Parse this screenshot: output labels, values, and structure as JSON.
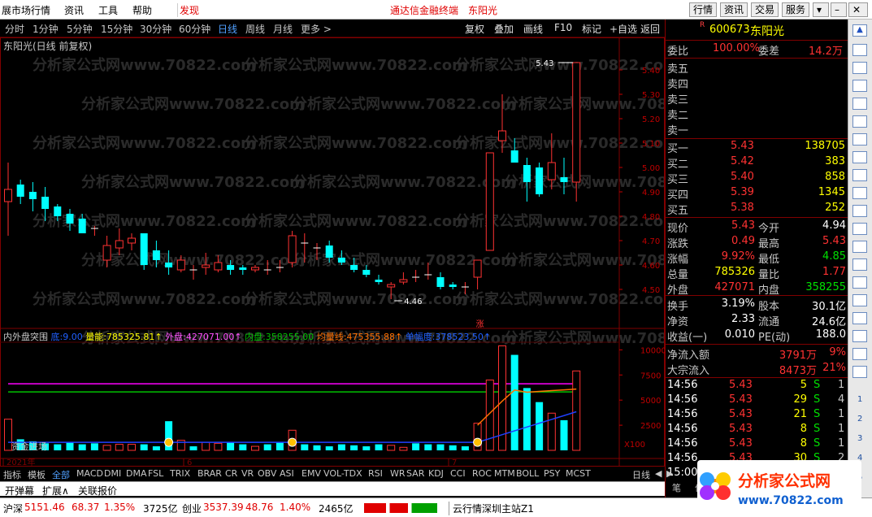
{
  "menubar": {
    "items": [
      "展市场行情",
      "资讯",
      "工具",
      "帮助"
    ],
    "discover": "发现",
    "title": "通达信金融终端",
    "stock_name": "东阳光",
    "buttons": [
      "行情",
      "资讯",
      "交易",
      "服务"
    ]
  },
  "periods": {
    "items": [
      "分时",
      "1分钟",
      "5分钟",
      "15分钟",
      "30分钟",
      "60分钟",
      "日线",
      "周线",
      "月线",
      "更多 >"
    ],
    "active": "日线",
    "right_buttons": [
      "复权",
      "叠加",
      "画线",
      "F10",
      "标记",
      "+自选",
      "返回"
    ]
  },
  "chart_title": "东阳光(日线 前复权)",
  "watermark": "分析家公式网www.70822.com",
  "chart_data": [
    {
      "type": "candlestick",
      "title": "东阳光(日线 前复权)",
      "ylim": [
        4.4,
        5.5
      ],
      "y_ticks": [
        "5.40",
        "5.30",
        "5.20",
        "5.10",
        "5.00",
        "4.90",
        "4.80",
        "4.70",
        "4.60",
        "4.50"
      ],
      "high_label": "5.43",
      "low_label": "4.46",
      "limit_up_tag": "涨",
      "candles": [
        {
          "o": 4.86,
          "c": 4.91,
          "h": 5.02,
          "l": 4.72
        },
        {
          "o": 4.93,
          "c": 4.88,
          "h": 4.95,
          "l": 4.85
        },
        {
          "o": 4.9,
          "c": 4.87,
          "h": 4.94,
          "l": 4.82
        },
        {
          "o": 4.88,
          "c": 4.83,
          "h": 4.92,
          "l": 4.78
        },
        {
          "o": 4.84,
          "c": 4.8,
          "h": 4.85,
          "l": 4.78
        },
        {
          "o": 4.81,
          "c": 4.77,
          "h": 4.83,
          "l": 4.74
        },
        {
          "o": 4.79,
          "c": 4.73,
          "h": 4.81,
          "l": 4.73
        },
        {
          "o": 4.75,
          "c": 4.75,
          "h": 4.76,
          "l": 4.72
        },
        {
          "o": 4.62,
          "c": 4.68,
          "h": 4.72,
          "l": 4.59
        },
        {
          "o": 4.67,
          "c": 4.7,
          "h": 4.75,
          "l": 4.64
        },
        {
          "o": 4.69,
          "c": 4.71,
          "h": 4.73,
          "l": 4.66
        },
        {
          "o": 4.73,
          "c": 4.6,
          "h": 4.73,
          "l": 4.58
        },
        {
          "o": 4.66,
          "c": 4.62,
          "h": 4.7,
          "l": 4.59
        },
        {
          "o": 4.61,
          "c": 4.59,
          "h": 4.66,
          "l": 4.56
        },
        {
          "o": 4.58,
          "c": 4.62,
          "h": 4.64,
          "l": 4.57
        },
        {
          "o": 4.58,
          "c": 4.58,
          "h": 4.6,
          "l": 4.54
        },
        {
          "o": 4.59,
          "c": 4.6,
          "h": 4.65,
          "l": 4.56
        },
        {
          "o": 4.58,
          "c": 4.61,
          "h": 4.64,
          "l": 4.57
        },
        {
          "o": 4.6,
          "c": 4.58,
          "h": 4.62,
          "l": 4.56
        },
        {
          "o": 4.59,
          "c": 4.58,
          "h": 4.6,
          "l": 4.56
        },
        {
          "o": 4.58,
          "c": 4.59,
          "h": 4.6,
          "l": 4.57
        },
        {
          "o": 4.58,
          "c": 4.58,
          "h": 4.62,
          "l": 4.56
        },
        {
          "o": 4.59,
          "c": 4.59,
          "h": 4.62,
          "l": 4.57
        },
        {
          "o": 4.61,
          "c": 4.72,
          "h": 4.74,
          "l": 4.59
        },
        {
          "o": 4.69,
          "c": 4.69,
          "h": 4.73,
          "l": 4.61
        },
        {
          "o": 4.67,
          "c": 4.67,
          "h": 4.69,
          "l": 4.62
        },
        {
          "o": 4.68,
          "c": 4.63,
          "h": 4.7,
          "l": 4.61
        },
        {
          "o": 4.63,
          "c": 4.61,
          "h": 4.66,
          "l": 4.6
        },
        {
          "o": 4.6,
          "c": 4.58,
          "h": 4.63,
          "l": 4.57
        },
        {
          "o": 4.58,
          "c": 4.56,
          "h": 4.6,
          "l": 4.55
        },
        {
          "o": 4.54,
          "c": 4.53,
          "h": 4.56,
          "l": 4.52
        },
        {
          "o": 4.51,
          "c": 4.52,
          "h": 4.53,
          "l": 4.46
        },
        {
          "o": 4.53,
          "c": 4.54,
          "h": 4.57,
          "l": 4.52
        },
        {
          "o": 4.55,
          "c": 4.55,
          "h": 4.58,
          "l": 4.53
        },
        {
          "o": 4.56,
          "c": 4.56,
          "h": 4.61,
          "l": 4.54
        },
        {
          "o": 4.55,
          "c": 4.51,
          "h": 4.57,
          "l": 4.5
        },
        {
          "o": 4.52,
          "c": 4.51,
          "h": 4.53,
          "l": 4.5
        },
        {
          "o": 4.51,
          "c": 4.51,
          "h": 4.53,
          "l": 4.48
        },
        {
          "o": 4.55,
          "c": 4.62,
          "h": 4.62,
          "l": 4.5
        },
        {
          "o": 4.66,
          "c": 5.06,
          "h": 5.06,
          "l": 4.66
        },
        {
          "o": 5.11,
          "c": 5.15,
          "h": 5.3,
          "l": 5.06
        },
        {
          "o": 5.07,
          "c": 5.02,
          "h": 5.12,
          "l": 5.02
        },
        {
          "o": 5.01,
          "c": 4.94,
          "h": 5.04,
          "l": 4.86
        },
        {
          "o": 5.0,
          "c": 4.89,
          "h": 5.02,
          "l": 4.88
        },
        {
          "o": 4.95,
          "c": 5.02,
          "h": 5.14,
          "l": 4.91
        },
        {
          "o": 4.96,
          "c": 4.94,
          "h": 5.04,
          "l": 4.89
        },
        {
          "o": 4.94,
          "c": 5.43,
          "h": 5.43,
          "l": 4.86
        }
      ]
    },
    {
      "type": "bar",
      "title": "内外盘突围",
      "header": [
        {
          "name": "底",
          "value": "9.00"
        },
        {
          "name": "量能",
          "value": "785325.81↑"
        },
        {
          "name": "外盘",
          "value": "427071.00↑"
        },
        {
          "name": "内盘",
          "value": "358255.00"
        },
        {
          "name": "均量线",
          "value": "475355.88↑"
        },
        {
          "name": "单幅度",
          "value": "378523.50↑"
        }
      ],
      "overlay_label": "资金进场",
      "y_ticks": [
        "10000",
        "7500",
        "5000",
        "2500"
      ],
      "x100": "X100",
      "x_labels": [
        "2021年",
        "6",
        "7"
      ],
      "ylim": [
        0,
        11000
      ],
      "volumes": [
        3100,
        1100,
        900,
        700,
        600,
        800,
        600,
        700,
        500,
        600,
        600,
        600,
        400,
        2900,
        1000,
        400,
        800,
        700,
        800,
        600,
        400,
        600,
        800,
        2000,
        600,
        500,
        400,
        600,
        500,
        400,
        600,
        500,
        300,
        700,
        600,
        600,
        500,
        400,
        2700,
        7000,
        10400,
        9500,
        6200,
        4800,
        3700,
        3000,
        7900
      ],
      "up_flags": [
        1,
        0,
        0,
        0,
        0,
        0,
        0,
        0,
        1,
        1,
        1,
        0,
        0,
        0,
        1,
        0,
        1,
        1,
        0,
        0,
        1,
        0,
        0,
        1,
        0,
        0,
        0,
        0,
        0,
        0,
        0,
        1,
        1,
        0,
        0,
        0,
        0,
        0,
        1,
        1,
        1,
        0,
        0,
        0,
        1,
        0,
        1
      ],
      "signal_dots": [
        13,
        23,
        38
      ]
    }
  ],
  "quote": {
    "code": "600673",
    "name": "东阳光",
    "r_tag": "R",
    "weibi_label": "委比",
    "weibi": "100.00%",
    "weicha_label": "委差",
    "weicha": "14.2万",
    "sells": [
      {
        "label": "卖五",
        "price": "",
        "vol": ""
      },
      {
        "label": "卖四",
        "price": "",
        "vol": ""
      },
      {
        "label": "卖三",
        "price": "",
        "vol": ""
      },
      {
        "label": "卖二",
        "price": "",
        "vol": ""
      },
      {
        "label": "卖一",
        "price": "",
        "vol": ""
      }
    ],
    "buys": [
      {
        "label": "买一",
        "price": "5.43",
        "vol": "138705"
      },
      {
        "label": "买二",
        "price": "5.42",
        "vol": "383"
      },
      {
        "label": "买三",
        "price": "5.40",
        "vol": "858"
      },
      {
        "label": "买四",
        "price": "5.39",
        "vol": "1345"
      },
      {
        "label": "买五",
        "price": "5.38",
        "vol": "252"
      }
    ],
    "stats": [
      {
        "l1": "现价",
        "v1": "5.43",
        "c1": "red",
        "l2": "今开",
        "v2": "4.94",
        "c2": "wht"
      },
      {
        "l1": "涨跌",
        "v1": "0.49",
        "c1": "red",
        "l2": "最高",
        "v2": "5.43",
        "c2": "red"
      },
      {
        "l1": "涨幅",
        "v1": "9.92%",
        "c1": "red",
        "l2": "最低",
        "v2": "4.85",
        "c2": "grn"
      },
      {
        "l1": "总量",
        "v1": "785326",
        "c1": "yel",
        "l2": "量比",
        "v2": "1.77",
        "c2": "red"
      },
      {
        "l1": "外盘",
        "v1": "427071",
        "c1": "red",
        "l2": "内盘",
        "v2": "358255",
        "c2": "grn"
      }
    ],
    "stats2": [
      {
        "l1": "换手",
        "v1": "3.19%",
        "l2": "股本",
        "v2": "30.1亿"
      },
      {
        "l1": "净资",
        "v1": "2.33",
        "l2": "流通",
        "v2": "24.6亿"
      },
      {
        "l1": "收益(一)",
        "v1": "0.010",
        "l2": "PE(动)",
        "v2": "188.0"
      }
    ],
    "flows": [
      {
        "label": "净流入额",
        "value": "3791万",
        "pct": "9%"
      },
      {
        "label": "大宗流入",
        "value": "8473万",
        "pct": "21%"
      }
    ],
    "ticks": [
      {
        "time": "14:56",
        "price": "5.43",
        "vol": "5",
        "side": "S",
        "n": "1"
      },
      {
        "time": "14:56",
        "price": "5.43",
        "vol": "29",
        "side": "S",
        "n": "4"
      },
      {
        "time": "14:56",
        "price": "5.43",
        "vol": "21",
        "side": "S",
        "n": "1"
      },
      {
        "time": "14:56",
        "price": "5.43",
        "vol": "8",
        "side": "S",
        "n": "1"
      },
      {
        "time": "14:56",
        "price": "5.43",
        "vol": "8",
        "side": "S",
        "n": "1"
      },
      {
        "time": "14:56",
        "price": "5.43",
        "vol": "30",
        "side": "S",
        "n": "2"
      },
      {
        "time": "15:00",
        "price": "",
        "vol": "",
        "side": "",
        "n": ""
      }
    ],
    "bottom_tabs": [
      "笔",
      "价"
    ]
  },
  "right_toolbar": {
    "numbers": [
      "1",
      "2",
      "3",
      "4",
      "5"
    ]
  },
  "bottom_tabs": [
    "指标",
    "模板",
    "全部",
    "MACD",
    "DMI",
    "DMA",
    "FSL",
    "TRIX",
    "BRAR",
    "CR",
    "VR",
    "OBV",
    "ASI",
    "EMV",
    "VOL-TDX",
    "RSI",
    "WR",
    "SAR",
    "KDJ",
    "CCI",
    "ROC",
    "MTM",
    "BOLL",
    "PSY",
    "MCST"
  ],
  "bottom_right": [
    "日线",
    "◀",
    "▶"
  ],
  "sub_tabs": [
    "开弹幕",
    "扩展∧",
    "关联报价"
  ],
  "status": {
    "sh_label": "沪深",
    "sh_value": "5151.46",
    "sh_change": "68.37",
    "sh_pct": "1.35%",
    "sh_amount": "3725亿",
    "cy_label": "创业",
    "cy_value": "3537.39",
    "cy_change": "48.76",
    "cy_pct": "1.40%",
    "cy_amount": "2465亿",
    "server": "云行情深圳主站Z1"
  },
  "logo": {
    "cn": "分析家公式网",
    "url": "www.70822.com"
  },
  "colors": {
    "up": "#ff3232",
    "down": "#00ffff",
    "avg_orange": "#ff7000",
    "avg_blue": "#2040ff",
    "line_magenta": "#ff00ff",
    "line_green": "#00c000"
  }
}
